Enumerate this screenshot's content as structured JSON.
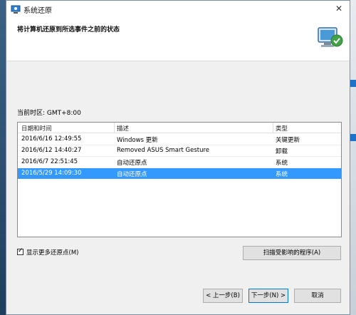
{
  "window": {
    "title": "系统还原"
  },
  "header": {
    "title": "将计算机还原到所选事件之前的状态"
  },
  "timezone": "当前时区: GMT+8:00",
  "table": {
    "columns": [
      "日期和时间",
      "描述",
      "类型"
    ],
    "rows": [
      {
        "date": "2016/6/16 12:49:55",
        "desc": "Windows 更新",
        "type": "关键更新",
        "selected": false
      },
      {
        "date": "2016/6/12 14:40:27",
        "desc": "Removed ASUS Smart Gesture",
        "type": "卸载",
        "selected": false
      },
      {
        "date": "2016/6/7 22:51:45",
        "desc": "自动还原点",
        "type": "系统",
        "selected": false
      },
      {
        "date": "2016/5/29 14:09:30",
        "desc": "自动还原点",
        "type": "系统",
        "selected": true
      }
    ]
  },
  "show_more": {
    "label": "显示更多还原点(M)",
    "checked": true
  },
  "buttons": {
    "scan": "扫描受影响的程序(A)",
    "back": "< 上一步(B)",
    "next": "下一步(N) >",
    "cancel": "取消"
  },
  "colors": {
    "selection": "#3399ff",
    "accent": "#0078d7"
  }
}
